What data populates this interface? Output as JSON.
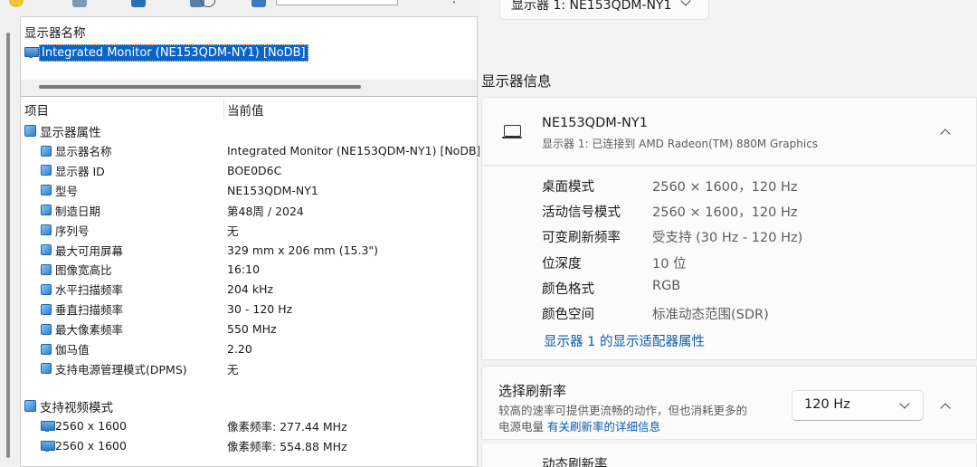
{
  "app": {
    "top_header": "显示器名称",
    "selected_monitor": "Integrated Monitor (NE153QDM-NY1) [NoDB]",
    "columns": {
      "item": "项目",
      "value": "当前值"
    },
    "group_properties": "显示器属性",
    "properties": [
      {
        "label": "显示器名称",
        "value": "Integrated Monitor (NE153QDM-NY1) [NoDB]"
      },
      {
        "label": "显示器 ID",
        "value": "BOE0D6C"
      },
      {
        "label": "型号",
        "value": "NE153QDM-NY1"
      },
      {
        "label": "制造日期",
        "value": "第48周 / 2024"
      },
      {
        "label": "序列号",
        "value": "无"
      },
      {
        "label": "最大可用屏幕",
        "value": "329 mm x 206 mm (15.3\")"
      },
      {
        "label": "图像宽高比",
        "value": "16:10"
      },
      {
        "label": "水平扫描频率",
        "value": "204 kHz"
      },
      {
        "label": "垂直扫描频率",
        "value": "30 - 120 Hz"
      },
      {
        "label": "最大像素频率",
        "value": "550 MHz"
      },
      {
        "label": "伽马值",
        "value": "2.20"
      },
      {
        "label": "支持电源管理模式(DPMS)",
        "value": "无"
      }
    ],
    "group_video_modes": "支持视频模式",
    "video_modes": [
      {
        "label": "2560 x 1600",
        "value": "像素频率: 277.44 MHz"
      },
      {
        "label": "2560 x 1600",
        "value": "像素频率: 554.88 MHz"
      }
    ]
  },
  "settings": {
    "display_select": "显示器 1: NE153QDM-NY1",
    "section_title": "显示器信息",
    "monitor_name": "NE153QDM-NY1",
    "monitor_sub": "显示器 1: 已连接到 AMD Radeon(TM) 880M Graphics",
    "info": [
      {
        "key": "桌面模式",
        "value": "2560 × 1600，120 Hz"
      },
      {
        "key": "活动信号模式",
        "value": "2560 × 1600，120 Hz"
      },
      {
        "key": "可变刷新频率",
        "value": "受支持 (30 Hz - 120 Hz)"
      },
      {
        "key": "位深度",
        "value": "10 位"
      },
      {
        "key": "颜色格式",
        "value": "RGB"
      },
      {
        "key": "颜色空间",
        "value": "标准动态范围(SDR)"
      }
    ],
    "adapter_link": "显示器 1 的显示适配器属性",
    "refresh": {
      "title": "选择刷新率",
      "desc_line1": "较高的速率可提供更流畅的动作，但也消耗更多的",
      "desc_line2": "电源电量",
      "link": "有关刷新率的详细信息",
      "selected": "120 Hz"
    },
    "dynamic_refresh": "动态刷新率"
  }
}
